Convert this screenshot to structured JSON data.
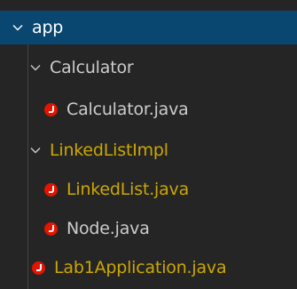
{
  "tree": {
    "root": {
      "label": "app",
      "expanded": true
    },
    "items": [
      {
        "label": "Calculator",
        "type": "folder",
        "expanded": true,
        "status": "normal"
      },
      {
        "label": "Calculator.java",
        "type": "java-file",
        "status": "normal"
      },
      {
        "label": "LinkedListImpl",
        "type": "folder",
        "expanded": true,
        "status": "warning"
      },
      {
        "label": "LinkedList.java",
        "type": "java-file",
        "status": "warning"
      },
      {
        "label": "Node.java",
        "type": "java-file",
        "status": "normal"
      },
      {
        "label": "Lab1Application.java",
        "type": "java-file",
        "status": "warning"
      }
    ]
  },
  "colors": {
    "background": "#252526",
    "selection": "#094771",
    "text": "#cccccc",
    "warning_text": "#cca700",
    "java_icon": "#e51400"
  },
  "icons": {
    "folder_expanded": "chevron-down-icon",
    "java_file": "java-file-icon"
  }
}
